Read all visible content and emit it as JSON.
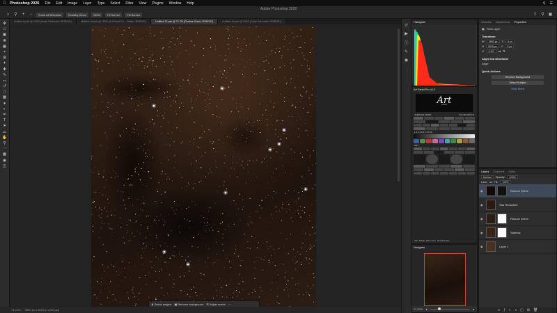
{
  "menubar": {
    "apple_icon": "apple-icon",
    "app_name": "Photoshop 2026",
    "items": [
      "File",
      "Edit",
      "Image",
      "Layer",
      "Type",
      "Select",
      "Filter",
      "View",
      "Plugins",
      "Window",
      "Help"
    ],
    "right_icons": [
      "search-icon",
      "control-center-icon"
    ]
  },
  "window_title": "Adobe Photoshop 2026",
  "optbar": {
    "buttons": [
      "Zoom All Windows",
      "Scrubby Zoom",
      "100%",
      "Fit Screen",
      "Fill Screen"
    ],
    "right_icons": [
      "share-icon",
      "search-icon",
      "layout-icon"
    ]
  },
  "tabs": [
    {
      "label": "Untitled-8.psb @ 100% (Noise Reduction, RGB/16*)",
      "active": false
    },
    {
      "label": "Untitled-10.psb @ 100% (Art Panel Pro - Flatten, RGB/16*)",
      "active": false
    },
    {
      "label": "Untitled-12.psb @ 71.2% (Reduce Green, RGB/16*)",
      "active": true
    },
    {
      "label": "Untitled-14.psb @ 100% (Color Correction, RGB/16*)",
      "active": false
    }
  ],
  "contextual_bar": {
    "select_subject": "Select subject",
    "remove_bg": "Remove background",
    "adjust_scene": "Adjust scene"
  },
  "status": {
    "zoom": "71.24%",
    "doc_info": "3900 px x 4519 px (240 ppi)"
  },
  "histogram": {
    "tab": "Histogram",
    "colors": {
      "red": "#ff2a1a",
      "yellow": "#f5e51a",
      "green": "#24e06a",
      "cyan": "#2ad6ff",
      "gray": "#8c8c8c"
    }
  },
  "art_panel": {
    "tab": "Art Panel Pro v3.0",
    "logo": "Art",
    "logo_sub": "panel",
    "labels": [
      "AVERAGE DRAW",
      "COLOR MATCH",
      "ART"
    ],
    "scale_numbers": "1 2 3 4 5 6 7 8 9 10",
    "footer": "ART PANEL PRO V3.0 · Bob Bertalan"
  },
  "navigator": {
    "tab": "Navigator",
    "zoom": "71.24%"
  },
  "properties": {
    "tabs": [
      "Libraries",
      "Adjustments",
      "Properties"
    ],
    "layer_type": "Pixel Layer",
    "transform_title": "Transform",
    "w": "3900 px",
    "h": "4519 px",
    "x": "0 px",
    "y": "0 px",
    "angle": "0.00°",
    "align_title": "Align and Distribute",
    "align_label": "Align:",
    "quick_title": "Quick Actions",
    "btn_remove_bg": "Remove Background",
    "btn_select_subject": "Select Subject",
    "link": "View More"
  },
  "layers": {
    "tabs": [
      "Layers",
      "Channels",
      "Paths"
    ],
    "blend_mode": "Normal",
    "opacity_label": "Opacity:",
    "opacity": "100%",
    "lock_label": "Lock:",
    "fill_label": "Fill:",
    "fill": "100%",
    "items": [
      {
        "name": "Reduce Green",
        "selected": true
      },
      {
        "name": "Star Reduction",
        "selected": false
      },
      {
        "name": "Reduce Green",
        "selected": false
      },
      {
        "name": "Starless",
        "selected": false
      },
      {
        "name": "Layer 1",
        "selected": false
      }
    ]
  },
  "toolbar_icons": [
    "move-tool-icon",
    "artboard-tool-icon",
    "marquee-tool-icon",
    "lasso-tool-icon",
    "object-select-tool-icon",
    "crop-tool-icon",
    "frame-tool-icon",
    "eyedropper-tool-icon",
    "spot-healing-tool-icon",
    "brush-tool-icon",
    "clone-stamp-tool-icon",
    "history-brush-tool-icon",
    "eraser-tool-icon",
    "gradient-tool-icon",
    "blur-tool-icon",
    "dodge-tool-icon",
    "pen-tool-icon",
    "type-tool-icon",
    "path-select-tool-icon",
    "rectangle-tool-icon",
    "hand-tool-icon",
    "zoom-tool-icon",
    "more-tools-icon",
    "swap-colors-icon",
    "quick-mask-icon",
    "screen-mode-icon"
  ]
}
